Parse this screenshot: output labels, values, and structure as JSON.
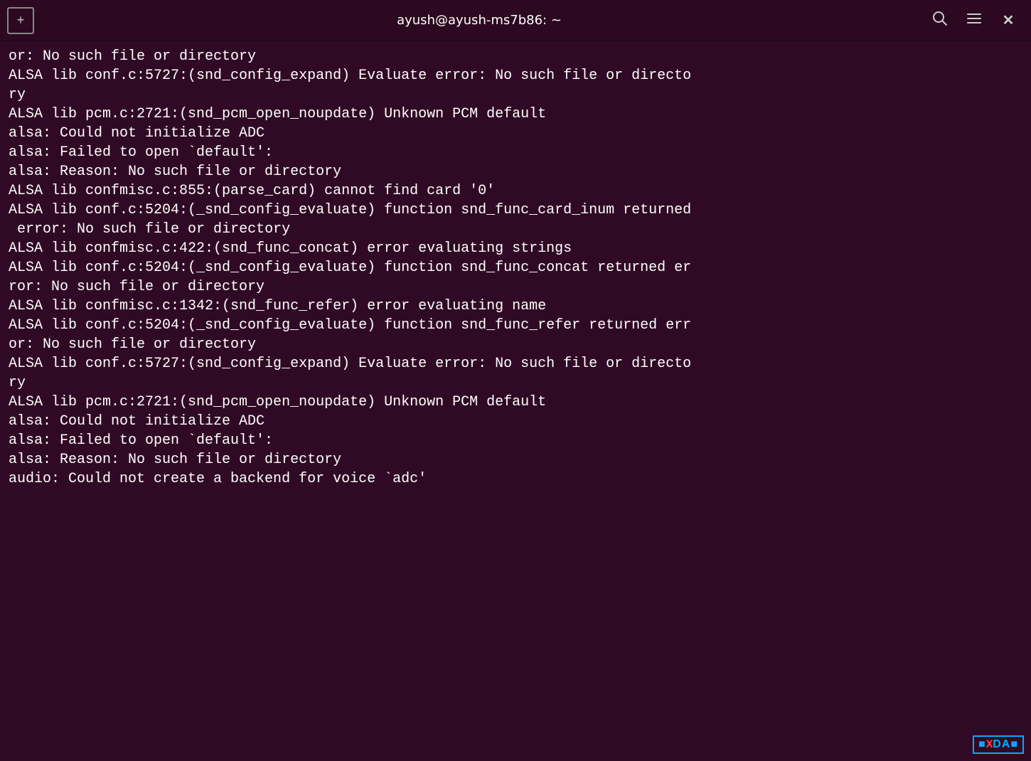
{
  "titlebar": {
    "new_tab_label": "+",
    "title": "ayush@ayush-ms7b86: ~",
    "search_icon": "🔍",
    "menu_icon": "☰",
    "close_icon": "✕"
  },
  "terminal": {
    "lines": [
      "or: No such file or directory",
      "ALSA lib conf.c:5727:(snd_config_expand) Evaluate error: No such file or directo",
      "ry",
      "ALSA lib pcm.c:2721:(snd_pcm_open_noupdate) Unknown PCM default",
      "alsa: Could not initialize ADC",
      "alsa: Failed to open `default':",
      "alsa: Reason: No such file or directory",
      "ALSA lib confmisc.c:855:(parse_card) cannot find card '0'",
      "ALSA lib conf.c:5204:(_snd_config_evaluate) function snd_func_card_inum returned",
      " error: No such file or directory",
      "ALSA lib confmisc.c:422:(snd_func_concat) error evaluating strings",
      "ALSA lib conf.c:5204:(_snd_config_evaluate) function snd_func_concat returned er",
      "ror: No such file or directory",
      "ALSA lib confmisc.c:1342:(snd_func_refer) error evaluating name",
      "ALSA lib conf.c:5204:(_snd_config_evaluate) function snd_func_refer returned err",
      "or: No such file or directory",
      "ALSA lib conf.c:5727:(snd_config_expand) Evaluate error: No such file or directo",
      "ry",
      "ALSA lib pcm.c:2721:(snd_pcm_open_noupdate) Unknown PCM default",
      "alsa: Could not initialize ADC",
      "alsa: Failed to open `default':",
      "alsa: Reason: No such file or directory",
      "audio: Could not create a backend for voice `adc'"
    ]
  },
  "watermark": {
    "text": "XDA"
  }
}
